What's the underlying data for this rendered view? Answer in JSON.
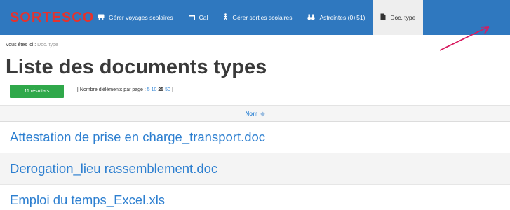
{
  "navbar": {
    "brand": "SORTESCO",
    "items": [
      {
        "label": "Gérer voyages scolaires",
        "icon": "bus-icon"
      },
      {
        "label": "Cal",
        "icon": "calendar-icon"
      },
      {
        "label": "Gérer sorties scolaires",
        "icon": "walking-person-icon"
      },
      {
        "label": "Astreintes (0+51)",
        "icon": "binoculars-icon"
      },
      {
        "label": "Doc. type",
        "icon": "document-icon"
      }
    ]
  },
  "breadcrumb": {
    "prefix": "Vous êtes ici :",
    "current": "Doc. type"
  },
  "page": {
    "title": "Liste des documents types"
  },
  "results": {
    "count_label": "11 résultats",
    "per_page_prefix": "[ Nombre d'éléments par page :",
    "per_page_options": [
      "5",
      "10",
      "25",
      "50"
    ],
    "per_page_selected": "25",
    "per_page_suffix": "]"
  },
  "table": {
    "header": "Nom",
    "rows": [
      "Attestation de prise en charge_transport.doc",
      "Derogation_lieu rassemblement.doc",
      "Emploi du temps_Excel.xls"
    ]
  },
  "colors": {
    "navbar_bg": "#2f78bf",
    "brand": "#e5322d",
    "badge_bg": "#2fa84a",
    "link": "#2d7fd0",
    "annotation_arrow": "#d81b60"
  }
}
